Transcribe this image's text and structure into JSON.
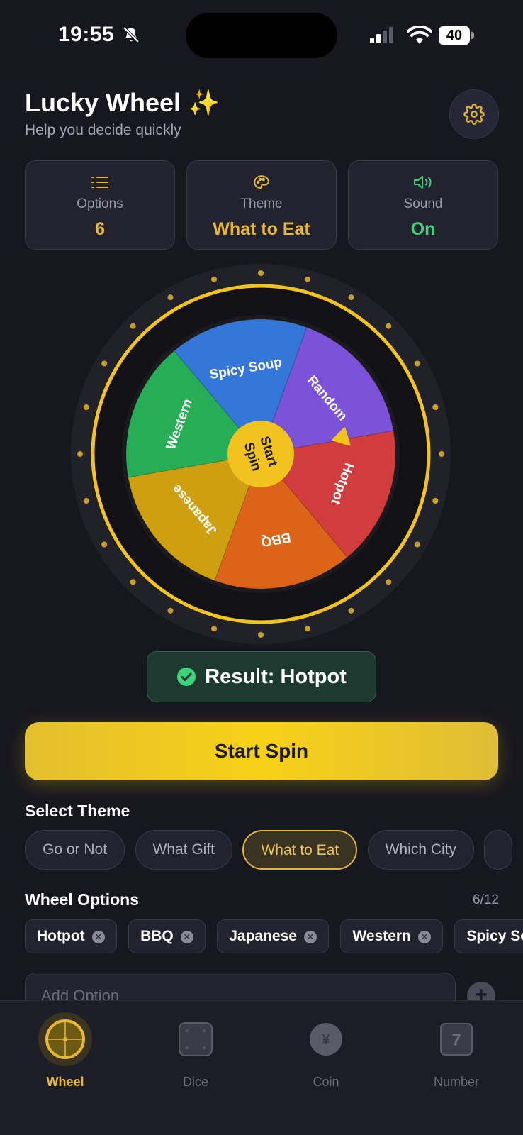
{
  "status_bar": {
    "time": "19:55",
    "battery": "40"
  },
  "header": {
    "title": "Lucky Wheel ✨",
    "subtitle": "Help you decide quickly"
  },
  "stats": [
    {
      "label": "Options",
      "value": "6",
      "icon": "list-icon"
    },
    {
      "label": "Theme",
      "value": "What to Eat",
      "icon": "palette-icon"
    },
    {
      "label": "Sound",
      "value": "On",
      "icon": "speaker-icon"
    }
  ],
  "wheel": {
    "segments": [
      {
        "label": "Hotpot",
        "color": "#d13c3c"
      },
      {
        "label": "BBQ",
        "color": "#db6418"
      },
      {
        "label": "Japanese",
        "color": "#cf9f12"
      },
      {
        "label": "Western",
        "color": "#27ad55"
      },
      {
        "label": "Spicy Soup",
        "color": "#3477d8"
      },
      {
        "label": "Random",
        "color": "#7b52d8"
      }
    ],
    "center_label_line1": "Start",
    "center_label_line2": "Spin",
    "rim_color": "#f2c31e"
  },
  "result": {
    "text": "Result: Hotpot"
  },
  "spin_button": {
    "label": "Start Spin"
  },
  "themes": {
    "title": "Select Theme",
    "items": [
      "Go or Not",
      "What Gift",
      "What to Eat",
      "Which City"
    ],
    "active": "What to Eat"
  },
  "options": {
    "title": "Wheel Options",
    "count": "6/12",
    "items": [
      "Hotpot",
      "BBQ",
      "Japanese",
      "Western",
      "Spicy Soup"
    ]
  },
  "add_option": {
    "placeholder": "Add Option"
  },
  "nav": [
    {
      "label": "Wheel",
      "icon": "wheel-icon",
      "active": true
    },
    {
      "label": "Dice",
      "icon": "dice-icon",
      "active": false
    },
    {
      "label": "Coin",
      "icon": "coin-icon",
      "active": false,
      "symbol": "¥"
    },
    {
      "label": "Number",
      "icon": "number-icon",
      "active": false,
      "symbol": "7"
    }
  ]
}
